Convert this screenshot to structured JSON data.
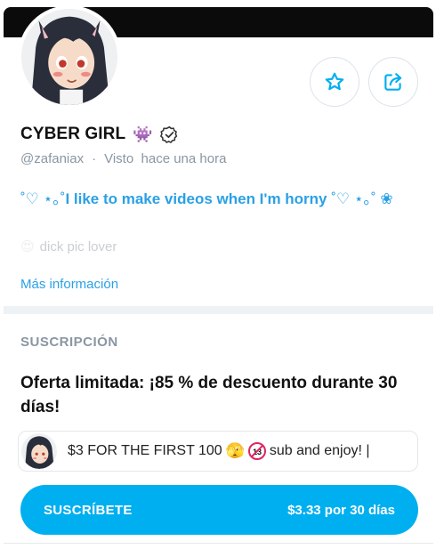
{
  "profile": {
    "display_name": "CYBER GIRL",
    "name_emoji": "👾",
    "handle": "@zafaniax",
    "separator": "·",
    "last_seen": "Visto  hace una hora",
    "bio_prefix": "˚♡ ⋆｡˚",
    "bio_text": "I like to make videos when I'm horny",
    "bio_suffix": "˚♡ ⋆｡˚ ❀",
    "faded_emoji": "😍",
    "faded_text": "dick pic lover",
    "more_info": "Más información"
  },
  "actions": {
    "favorite_icon": "star-icon",
    "share_icon": "share-icon"
  },
  "subscription": {
    "section_title": "SUSCRIPCIÓN",
    "offer_text": "Oferta limitada: ¡85 % de descuento durante 30 días!",
    "promo_text_start": "$3 FOR THE FIRST 100",
    "promo_emoji": "🫣",
    "promo_badge": "13",
    "promo_text_end": "sub and enjoy! |",
    "button_label": "SUSCRÍBETE",
    "button_price": "$3.33 por 30 días"
  },
  "colors": {
    "accent": "#00aff0",
    "link": "#2aa0e6",
    "muted": "#8a96a3"
  }
}
